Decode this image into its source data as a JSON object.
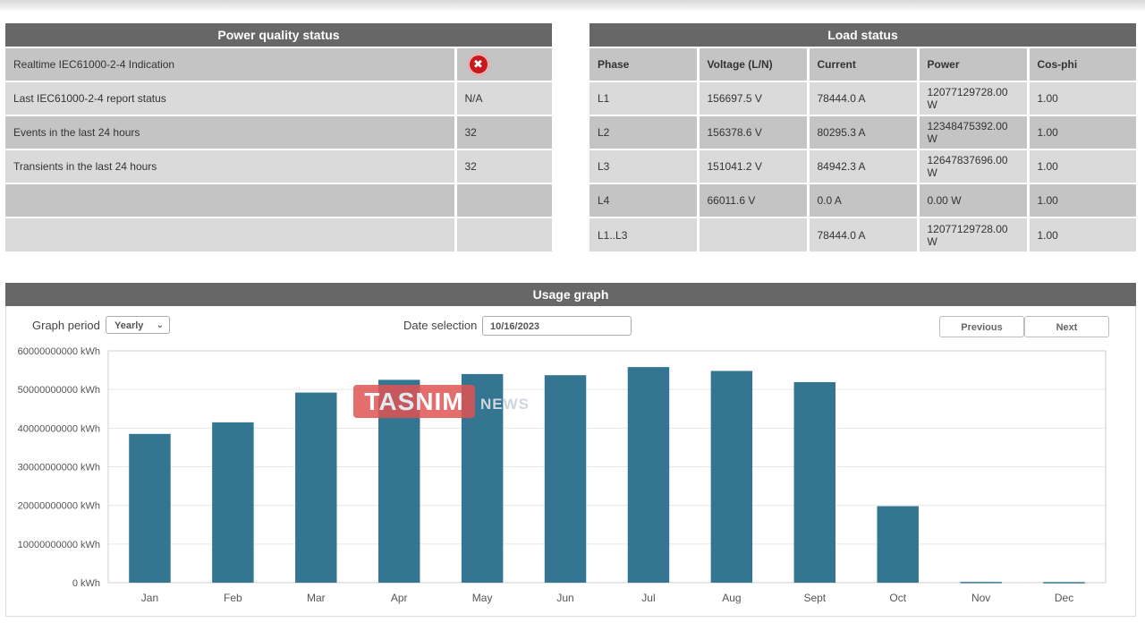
{
  "power_quality": {
    "title": "Power quality status",
    "rows": [
      {
        "label": "Realtime IEC61000-2-4 Indication",
        "value": "",
        "icon": "error-icon"
      },
      {
        "label": "Last IEC61000-2-4 report status",
        "value": "N/A"
      },
      {
        "label": "Events in the last 24 hours",
        "value": "32"
      },
      {
        "label": "Transients in the last 24 hours",
        "value": "32"
      },
      {
        "label": "",
        "value": ""
      },
      {
        "label": "",
        "value": ""
      }
    ]
  },
  "load_status": {
    "title": "Load status",
    "headers": [
      "Phase",
      "Voltage (L/N)",
      "Current",
      "Power",
      "Cos-phi"
    ],
    "rows": [
      [
        "L1",
        "156697.5 V",
        "78444.0 A",
        "12077129728.00 W",
        "1.00"
      ],
      [
        "L2",
        "156378.6 V",
        "80295.3 A",
        "12348475392.00 W",
        "1.00"
      ],
      [
        "L3",
        "151041.2 V",
        "84942.3 A",
        "12647837696.00 W",
        "1.00"
      ],
      [
        "L4",
        "66011.6 V",
        "0.0 A",
        "0.00 W",
        "1.00"
      ],
      [
        "L1..L3",
        "",
        "78444.0 A",
        "12077129728.00 W",
        "1.00"
      ]
    ]
  },
  "usage_graph": {
    "title": "Usage graph",
    "period_label": "Graph period",
    "period_value": "Yearly",
    "date_label": "Date selection",
    "date_value": "10/16/2023",
    "previous_label": "Previous",
    "next_label": "Next"
  },
  "watermark": {
    "main": "TASNIM",
    "tail": "NEWS"
  },
  "colors": {
    "bar": "#347592",
    "header": "#676767",
    "error": "#c9171e"
  },
  "chart_data": {
    "type": "bar",
    "categories": [
      "Jan",
      "Feb",
      "Mar",
      "Apr",
      "May",
      "Jun",
      "Jul",
      "Aug",
      "Sept",
      "Oct",
      "Nov",
      "Dec"
    ],
    "values": [
      38500000000,
      41500000000,
      49200000000,
      52500000000,
      54000000000,
      53700000000,
      55800000000,
      54800000000,
      51900000000,
      19800000000,
      200000000,
      150000000
    ],
    "ylim": [
      0,
      60000000000
    ],
    "yticks": [
      0,
      10000000000,
      20000000000,
      30000000000,
      40000000000,
      50000000000,
      60000000000
    ],
    "ytick_labels": [
      "0 kWh",
      "10000000000 kWh",
      "20000000000 kWh",
      "30000000000 kWh",
      "40000000000 kWh",
      "50000000000 kWh",
      "60000000000 kWh"
    ],
    "grid": true,
    "title": "",
    "xlabel": "",
    "ylabel": ""
  }
}
